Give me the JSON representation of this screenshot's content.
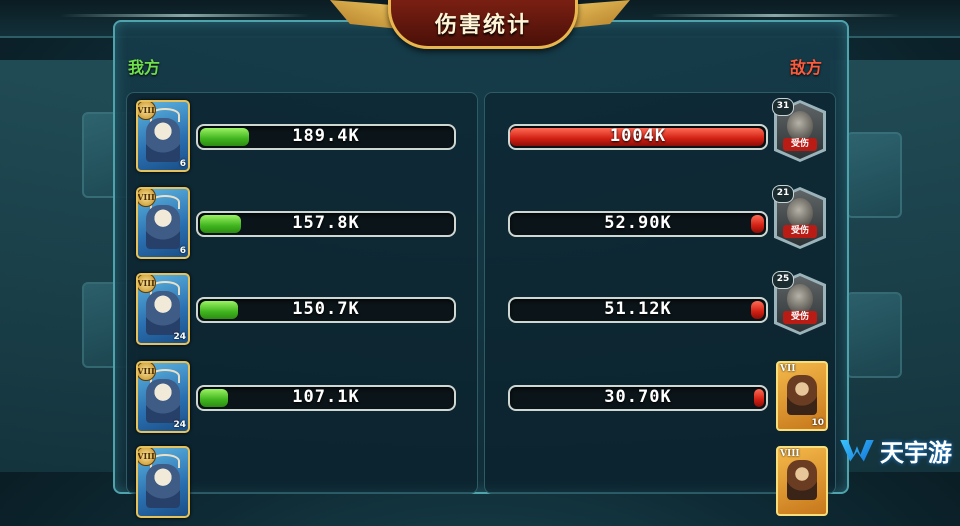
{
  "title": "伤害统计",
  "ally_label": "我方",
  "enemy_label": "敌方",
  "watermark": "天宇游",
  "colors": {
    "ally_accent": "#6fe04a",
    "enemy_accent": "#ff5a3a",
    "bar_green": "#3fb41e",
    "bar_red": "#d01f12"
  },
  "ally": {
    "rows": [
      {
        "rank": "VIII",
        "level": "6",
        "damage": "189.4K",
        "fill": 0.19
      },
      {
        "rank": "VIII",
        "level": "6",
        "damage": "157.8K",
        "fill": 0.16
      },
      {
        "rank": "VIII",
        "level": "24",
        "damage": "150.7K",
        "fill": 0.15
      },
      {
        "rank": "VIII",
        "level": "24",
        "damage": "107.1K",
        "fill": 0.11
      },
      {
        "rank": "VIII",
        "level": "",
        "damage": "",
        "fill": 0
      }
    ]
  },
  "enemy": {
    "rows": [
      {
        "level": "31",
        "status": "受伤",
        "damage": "1004K",
        "fill": 1.0,
        "card": "injured"
      },
      {
        "level": "21",
        "status": "受伤",
        "damage": "52.90K",
        "fill": 0.05,
        "card": "injured"
      },
      {
        "level": "25",
        "status": "受伤",
        "damage": "51.12K",
        "fill": 0.05,
        "card": "injured"
      },
      {
        "rank": "VII",
        "level": "10",
        "damage": "30.70K",
        "fill": 0.03,
        "card": "gold"
      },
      {
        "rank": "VIII",
        "level": "",
        "damage": "",
        "fill": 0,
        "card": "gold"
      }
    ]
  }
}
